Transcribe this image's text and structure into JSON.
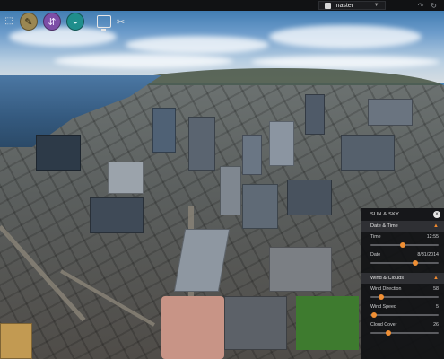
{
  "topbar": {
    "branch_label": "master",
    "icons": [
      "branch-icon",
      "chevron-down-icon",
      "redo-icon",
      "refresh-icon"
    ]
  },
  "toolbar": {
    "tools": [
      {
        "name": "select-tool",
        "icon": "cursor-icon"
      },
      {
        "name": "sun-tool",
        "icon": "sun-icon",
        "color": "#9b8752"
      },
      {
        "name": "layers-tool",
        "icon": "layers-icon",
        "color": "#7d4ea7"
      },
      {
        "name": "globe-tool",
        "icon": "globe-icon",
        "color": "#1f8e8c"
      },
      {
        "name": "present-tool",
        "icon": "monitor-icon"
      },
      {
        "name": "settings-tool",
        "icon": "wrench-icon"
      }
    ]
  },
  "panel": {
    "title": "SUN & SKY",
    "accent_color": "#f08f34",
    "sections": [
      {
        "title": "Date & Time",
        "rows": [
          {
            "label": "Time",
            "value": "12:55",
            "fraction": 0.48
          },
          {
            "label": "Date",
            "value": "8/31/2014",
            "fraction": 0.66
          }
        ]
      },
      {
        "title": "Wind & Clouds",
        "rows": [
          {
            "label": "Wind Direction",
            "value": "58",
            "fraction": 0.16
          },
          {
            "label": "Wind Speed",
            "value": "5",
            "fraction": 0.05
          },
          {
            "label": "Cloud Cover",
            "value": "26",
            "fraction": 0.26
          }
        ]
      }
    ]
  }
}
